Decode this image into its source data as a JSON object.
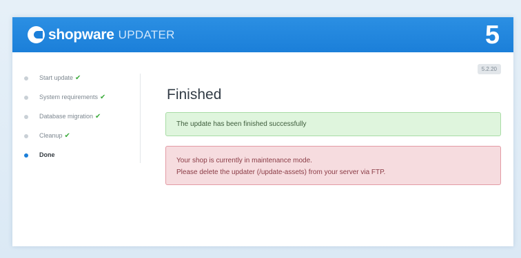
{
  "header": {
    "brand": "shopware",
    "subtitle": "UPDATER",
    "version_mark": "5"
  },
  "sidebar": {
    "steps": [
      {
        "label": "Start update",
        "done": true
      },
      {
        "label": "System requirements",
        "done": true
      },
      {
        "label": "Database migration",
        "done": true
      },
      {
        "label": "Cleanup",
        "done": true
      },
      {
        "label": "Done",
        "done": false,
        "active": true
      }
    ],
    "check_glyph": "✔"
  },
  "main": {
    "version": "5.2.20",
    "title": "Finished",
    "success_message": "The update has been finished successfully",
    "warning_lines": [
      "Your shop is currently in maintenance mode.",
      "Please delete the updater (/update-assets) from your server via FTP."
    ]
  },
  "colors": {
    "header_blue": "#1b7fd9",
    "success_bg": "#dff5dd",
    "danger_bg": "#f6dcdf",
    "check_green": "#3cab3c"
  }
}
